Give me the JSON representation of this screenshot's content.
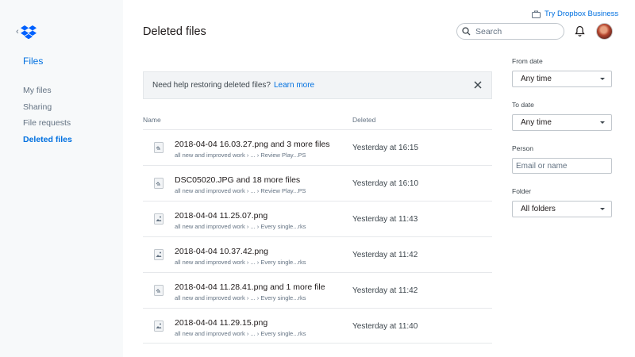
{
  "sidebar": {
    "back_glyph": "‹",
    "logo_icon": "dropbox-logo-icon",
    "title": "Files",
    "items": [
      {
        "label": "My files",
        "active": false
      },
      {
        "label": "Sharing",
        "active": false
      },
      {
        "label": "File requests",
        "active": false
      },
      {
        "label": "Deleted files",
        "active": true
      }
    ]
  },
  "header": {
    "promo_label": "Try Dropbox Business",
    "page_title": "Deleted files",
    "search_placeholder": "Search",
    "bell_icon": "bell-icon",
    "avatar_icon": "user-avatar"
  },
  "banner": {
    "text": "Need help restoring deleted files?",
    "link": "Learn more"
  },
  "table": {
    "columns": {
      "name": "Name",
      "deleted": "Deleted"
    },
    "rows": [
      {
        "name": "2018-04-04 16.03.27.png and 3 more files",
        "path": "all new and improved work  ›  ...  ›  Review Play...PS",
        "deleted": "Yesterday at 16:15",
        "icon": "file-stack-icon"
      },
      {
        "name": "DSC05020.JPG and 18 more files",
        "path": "all new and improved work  ›  ...  ›  Review Play...PS",
        "deleted": "Yesterday at 16:10",
        "icon": "file-stack-icon"
      },
      {
        "name": "2018-04-04 11.25.07.png",
        "path": "all new and improved work  ›  ...  ›  Every single...rks",
        "deleted": "Yesterday at 11:43",
        "icon": "image-file-icon"
      },
      {
        "name": "2018-04-04 10.37.42.png",
        "path": "all new and improved work  ›  ...  ›  Every single...rks",
        "deleted": "Yesterday at 11:42",
        "icon": "image-file-icon"
      },
      {
        "name": "2018-04-04 11.28.41.png and 1 more file",
        "path": "all new and improved work  ›  ...  ›  Every single...rks",
        "deleted": "Yesterday at 11:42",
        "icon": "file-stack-icon"
      },
      {
        "name": "2018-04-04 11.29.15.png",
        "path": "all new and improved work  ›  ...  ›  Every single...rks",
        "deleted": "Yesterday at 11:40",
        "icon": "image-file-icon"
      }
    ]
  },
  "filters": {
    "from_date": {
      "label": "From date",
      "value": "Any time"
    },
    "to_date": {
      "label": "To date",
      "value": "Any time"
    },
    "person": {
      "label": "Person",
      "placeholder": "Email or name"
    },
    "folder": {
      "label": "Folder",
      "value": "All folders"
    }
  },
  "colors": {
    "accent": "#0070e0",
    "text": "#1e1919",
    "muted": "#637282",
    "sidebar_bg": "#f7f9fa",
    "banner_bg": "#f2f4f6"
  }
}
